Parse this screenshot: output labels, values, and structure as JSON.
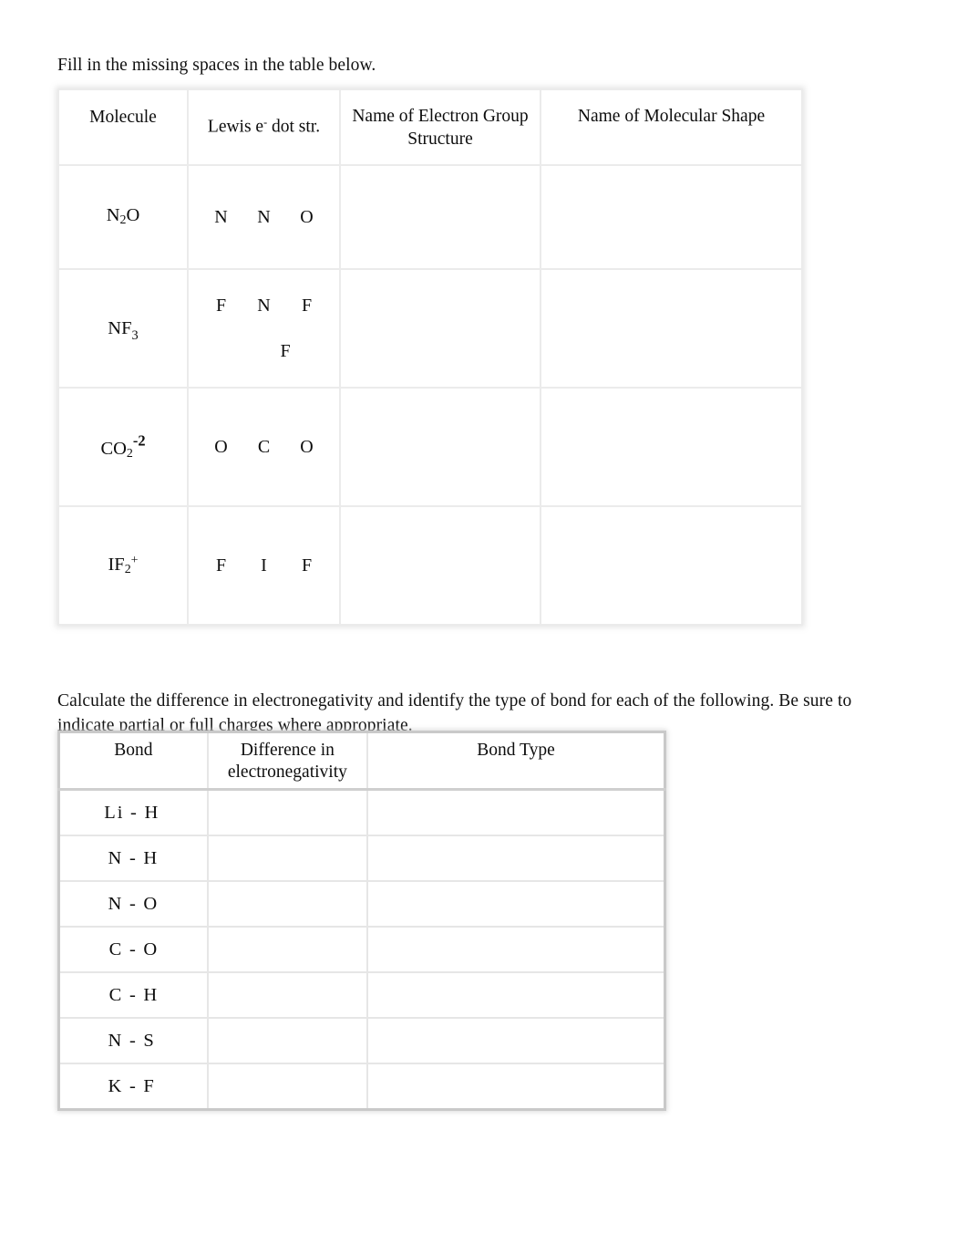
{
  "document": {
    "prompt_1": "Fill in the missing spaces in the table below.",
    "prompt_2": "Calculate the difference in electronegativity and identify the type of bond for each of the following.  Be sure to indicate partial or full charges where appropriate."
  },
  "molecule_table": {
    "headers": {
      "molecule": "Molecule",
      "lewis_prefix": "Lewis e",
      "lewis_superscript": "-",
      "lewis_suffix": " dot str.",
      "electron_group_line1": "Name of Electron Group",
      "electron_group_line2": "Structure",
      "molecular_shape": "Name of Molecular Shape"
    },
    "rows": [
      {
        "formula_base": "N",
        "formula_sub": "2",
        "formula_tail": "O",
        "formula_charge": "",
        "lewis_row1": [
          "N",
          "N",
          "O"
        ],
        "lewis_row2": [],
        "electron_group_structure": "",
        "molecular_shape": ""
      },
      {
        "formula_base": "NF",
        "formula_sub": "3",
        "formula_tail": "",
        "formula_charge": "",
        "lewis_row1": [
          "F",
          "N",
          "F"
        ],
        "lewis_row2": [
          "F"
        ],
        "electron_group_structure": "",
        "molecular_shape": ""
      },
      {
        "formula_base": "CO",
        "formula_sub": "2",
        "formula_tail": "",
        "formula_charge": "-2",
        "lewis_row1": [
          "O",
          "C",
          "O"
        ],
        "lewis_row2": [],
        "electron_group_structure": "",
        "molecular_shape": ""
      },
      {
        "formula_base": "IF",
        "formula_sub": "2",
        "formula_tail": "",
        "formula_charge": "+",
        "lewis_row1": [
          "F",
          "I",
          "F"
        ],
        "lewis_row2": [],
        "electron_group_structure": "",
        "molecular_shape": ""
      }
    ]
  },
  "bond_table": {
    "headers": {
      "bond": "Bond",
      "difference_line1": "Difference in",
      "difference_line2": "electronegativity",
      "bond_type": "Bond Type"
    },
    "rows": [
      {
        "atom_a": "Li",
        "dash": "-",
        "atom_b": "H",
        "difference": "",
        "bond_type": ""
      },
      {
        "atom_a": "N",
        "dash": "-",
        "atom_b": "H",
        "difference": "",
        "bond_type": ""
      },
      {
        "atom_a": "N",
        "dash": "-",
        "atom_b": "O",
        "difference": "",
        "bond_type": ""
      },
      {
        "atom_a": "C",
        "dash": "-",
        "atom_b": "O",
        "difference": "",
        "bond_type": ""
      },
      {
        "atom_a": "C",
        "dash": "-",
        "atom_b": "H",
        "difference": "",
        "bond_type": ""
      },
      {
        "atom_a": "N",
        "dash": "-",
        "atom_b": "S",
        "difference": "",
        "bond_type": ""
      },
      {
        "atom_a": "K",
        "dash": "-",
        "atom_b": "F",
        "difference": "",
        "bond_type": ""
      }
    ]
  },
  "colors": {
    "page_background": "#ffffff",
    "text": "#0d0d0d",
    "table1_border": "#e3e3e3",
    "table2_border": "#c9c9c9"
  }
}
